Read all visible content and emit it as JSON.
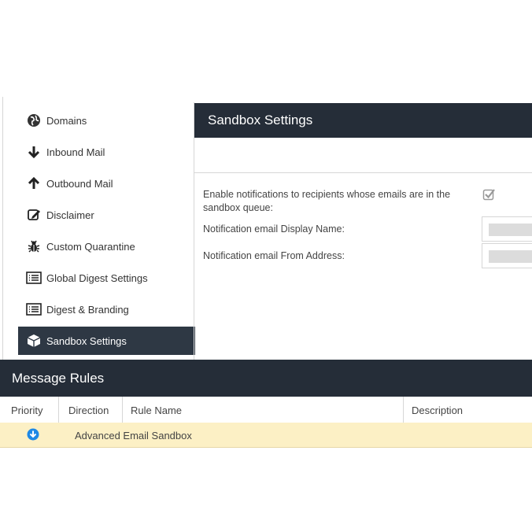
{
  "sidebar": {
    "items": [
      {
        "label": "Domains",
        "icon": "globe-icon"
      },
      {
        "label": "Inbound Mail",
        "icon": "arrow-down-icon"
      },
      {
        "label": "Outbound Mail",
        "icon": "arrow-up-icon"
      },
      {
        "label": "Disclaimer",
        "icon": "edit-icon"
      },
      {
        "label": "Custom Quarantine",
        "icon": "bug-icon"
      },
      {
        "label": "Global Digest Settings",
        "icon": "list-icon"
      },
      {
        "label": "Digest & Branding",
        "icon": "list-icon"
      },
      {
        "label": "Sandbox Settings",
        "icon": "cube-icon",
        "active": true
      }
    ]
  },
  "panel": {
    "title": "Sandbox Settings",
    "fields": {
      "enable_notifications_label": "Enable notifications to recipients whose emails are in the sandbox queue:",
      "enable_notifications_checked": true,
      "display_name_label": "Notification email Display Name:",
      "from_address_label": "Notification email From Address:"
    }
  },
  "rules": {
    "title": "Message Rules",
    "columns": [
      "Priority",
      "Direction",
      "Rule Name",
      "Description"
    ],
    "rows": [
      {
        "priority_icon": "arrow-circle-down-icon",
        "direction": "",
        "rule_name": "Advanced Email Sandbox",
        "description": ""
      }
    ]
  },
  "colors": {
    "header_bg": "#252d38",
    "active_item_bg": "#2e3844",
    "highlight_row": "#fcf0c5",
    "priority_icon": "#1e88e5"
  }
}
